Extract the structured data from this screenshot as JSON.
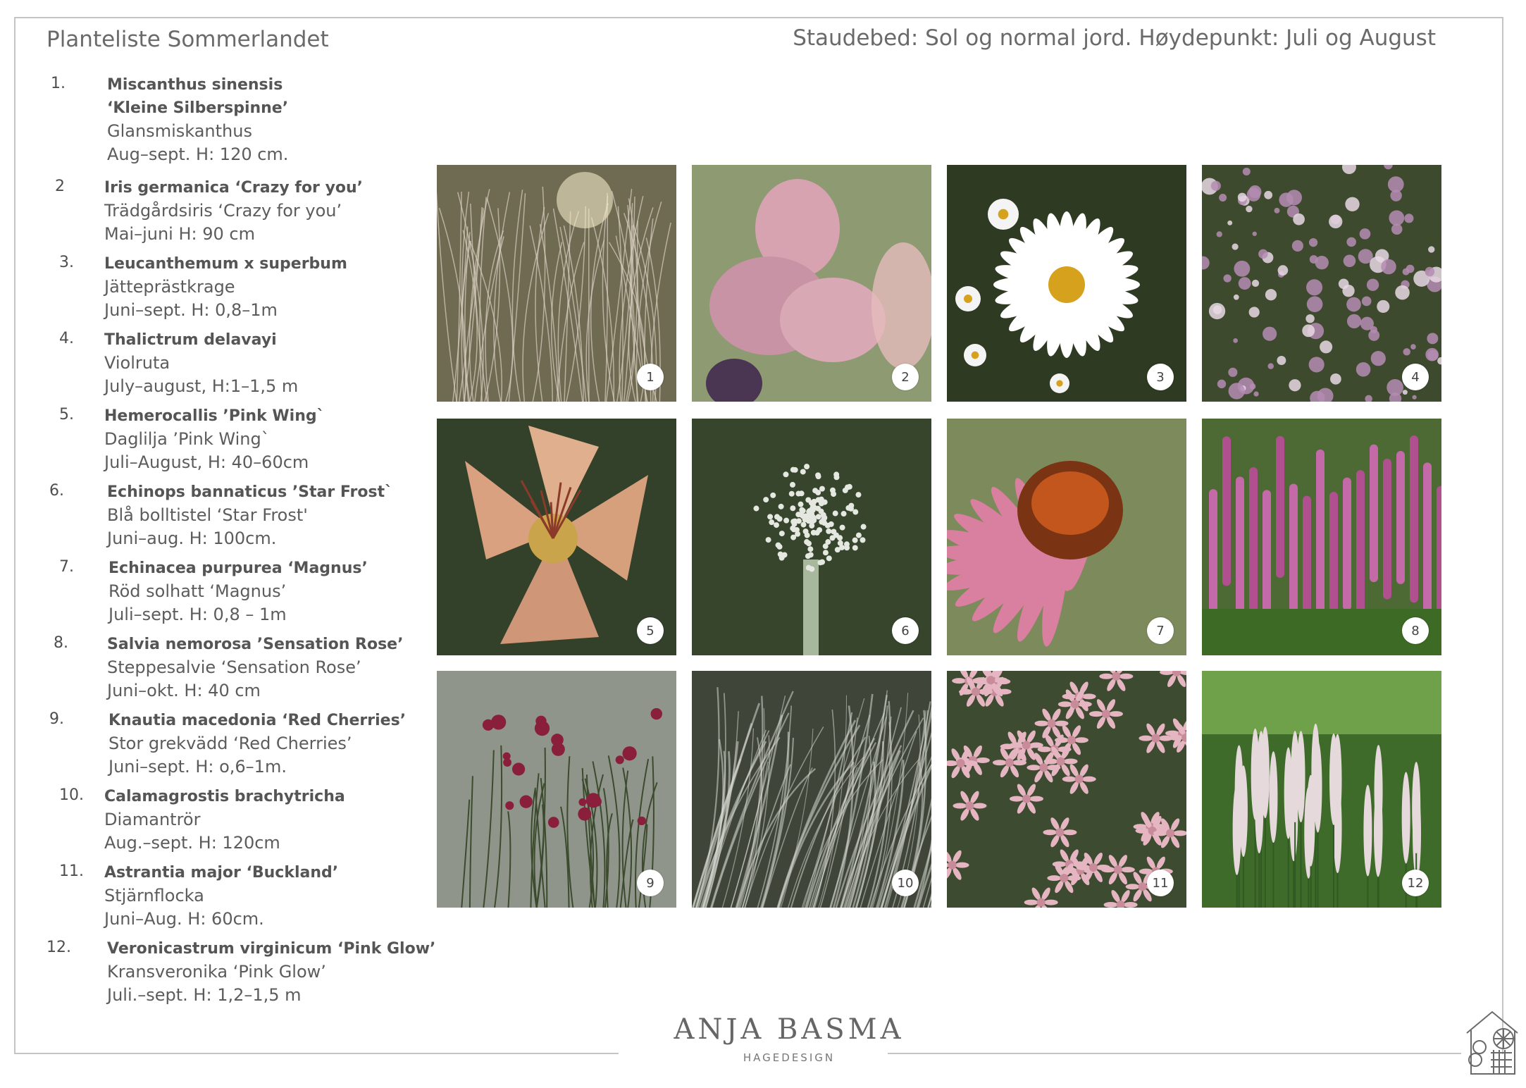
{
  "header": {
    "title": "Planteliste Sommerlandet",
    "subtitle": "Staudebed: Sol og normal jord. Høydepunkt: Juli og August"
  },
  "plants": [
    {
      "num": "1.",
      "latin": "Miscanthus sinensis",
      "latin2": "‘Kleine Silberspinne’",
      "common": "Glansmiskanthus",
      "bloom": "Aug–sept. H: 120 cm."
    },
    {
      "num": "2",
      "latin": "Iris germanica ‘Crazy for you’",
      "common": "Trädgårdsiris ‘Crazy for you’",
      "bloom": "Mai–juni H: 90 cm"
    },
    {
      "num": "3.",
      "latin": "Leucanthemum x superbum",
      "common": "Jätteprästkrage",
      "bloom": "Juni–sept.  H: 0,8–1m"
    },
    {
      "num": "4.",
      "latin": "Thalictrum delavayi",
      "common": "Violruta",
      "bloom": "July–august, H:1–1,5 m"
    },
    {
      "num": "5.",
      "latin": "Hemerocallis ’Pink Wing`",
      "common": "Daglilja ’Pink Wing`",
      "bloom": "Juli–August, H: 40–60cm"
    },
    {
      "num": "6.",
      "latin": "Echinops bannaticus ’Star Frost`",
      "common": "Blå bolltistel ‘Star Frost'",
      "bloom": "Juni–aug. H: 100cm."
    },
    {
      "num": "7.",
      "latin": "Echinacea purpurea ‘Magnus’",
      "common": "Röd solhatt ‘Magnus’",
      "bloom": "Juli–sept. H: 0,8 – 1m"
    },
    {
      "num": "8.",
      "latin": "Salvia nemorosa ’Sensation Rose’",
      "common": "Steppesalvie ‘Sensation Rose’",
      "bloom": "Juni–okt. H: 40 cm"
    },
    {
      "num": "9.",
      "latin": "Knautia macedonia  ‘Red Cherries’",
      "common": "Stor grekvädd ‘Red Cherries’",
      "bloom": "Juni–sept. H: o,6–1m."
    },
    {
      "num": "10.",
      "latin": "Calamagrostis brachytricha",
      "common": "Diamantrör",
      "bloom": "Aug.–sept. H: 120cm"
    },
    {
      "num": "11.",
      "latin": "Astrantia major ‘Buckland’",
      "common": "Stjärnflocka",
      "bloom": "Juni–Aug. H: 60cm."
    },
    {
      "num": "12.",
      "latin": "Veronicastrum virginicum ‘Pink Glow’",
      "common": "Kransveronika ‘Pink Glow’",
      "bloom": "Juli.–sept.  H: 1,2–1,5 m"
    }
  ],
  "photos": [
    {
      "label": "1",
      "subject": "ornamental-grass-photo",
      "bg": "#6f6a52",
      "accent": "#d9cfc0"
    },
    {
      "label": "2",
      "subject": "iris-photo",
      "bg": "#8d9a72",
      "accent": "#d7a3b1"
    },
    {
      "label": "3",
      "subject": "daisy-photo",
      "bg": "#2f3a22",
      "accent": "#ffffff"
    },
    {
      "label": "4",
      "subject": "thalictrum-photo",
      "bg": "#3e4a2e",
      "accent": "#b58cb3"
    },
    {
      "label": "5",
      "subject": "daylily-photo",
      "bg": "#33402a",
      "accent": "#d9a17f"
    },
    {
      "label": "6",
      "subject": "globe-thistle-photo",
      "bg": "#36452c",
      "accent": "#e4e8e0"
    },
    {
      "label": "7",
      "subject": "echinacea-photo",
      "bg": "#7d8a5c",
      "accent": "#d97fa0"
    },
    {
      "label": "8",
      "subject": "salvia-photo",
      "bg": "#4e6a34",
      "accent": "#b0508f"
    },
    {
      "label": "9",
      "subject": "knautia-photo",
      "bg": "#8f958a",
      "accent": "#8a1f3c"
    },
    {
      "label": "10",
      "subject": "feather-grass-photo",
      "bg": "#3f4538",
      "accent": "#d6d9d2"
    },
    {
      "label": "11",
      "subject": "astrantia-photo",
      "bg": "#3d4c30",
      "accent": "#e6b5c2"
    },
    {
      "label": "12",
      "subject": "veronicastrum-photo",
      "bg": "#3f6b2a",
      "accent": "#e6d9dc"
    }
  ],
  "brand": {
    "name": "ANJA BASMA",
    "tagline": "HAGEDESIGN"
  },
  "logo_icon": "house-garden-icon"
}
